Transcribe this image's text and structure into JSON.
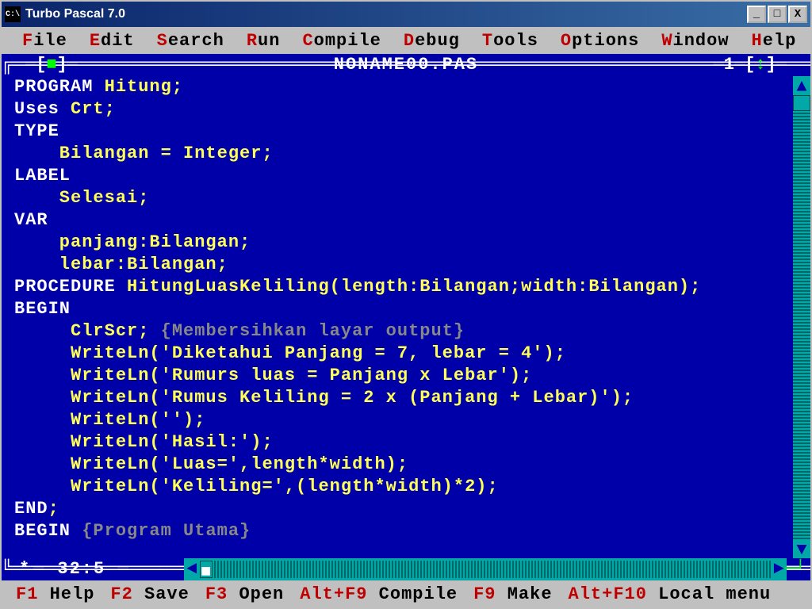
{
  "titlebar": {
    "icon_text": "C:\\",
    "title": "Turbo Pascal 7.0",
    "min": "_",
    "max": "□",
    "close": "X"
  },
  "menu": {
    "file": {
      "hot": "F",
      "rest": "ile"
    },
    "edit": {
      "hot": "E",
      "rest": "dit"
    },
    "search": {
      "hot": "S",
      "rest": "earch"
    },
    "run": {
      "hot": "R",
      "rest": "un"
    },
    "compile": {
      "hot": "C",
      "rest": "ompile"
    },
    "debug": {
      "hot": "D",
      "rest": "ebug"
    },
    "tools": {
      "hot": "T",
      "rest": "ools"
    },
    "options": {
      "hot": "O",
      "rest": "ptions"
    },
    "window": {
      "hot": "W",
      "rest": "indow"
    },
    "help": {
      "hot": "H",
      "rest": "elp"
    }
  },
  "editor": {
    "filename": "NONAME00.PAS",
    "window_num": "1",
    "cursor": "32:5",
    "modified": "*",
    "lines": [
      {
        "t": "PROGRAM",
        "r": " Hitung;",
        "kw": true
      },
      {
        "t": "Uses",
        "r": " Crt;",
        "kw": true
      },
      {
        "t": "TYPE",
        "r": "",
        "kw": true
      },
      {
        "t": "",
        "r": "    Bilangan = Integer;",
        "kw": false
      },
      {
        "t": "LABEL",
        "r": "",
        "kw": true
      },
      {
        "t": "",
        "r": "    Selesai;",
        "kw": false
      },
      {
        "t": "VAR",
        "r": "",
        "kw": true
      },
      {
        "t": "",
        "r": "    panjang:Bilangan;",
        "kw": false
      },
      {
        "t": "",
        "r": "    lebar:Bilangan;",
        "kw": false
      },
      {
        "t": "PROCEDURE",
        "r": " HitungLuasKeliling(length:Bilangan;width:Bilangan);",
        "kw": true
      },
      {
        "t": "BEGIN",
        "r": "",
        "kw": true
      },
      {
        "t": "",
        "r": "     ClrScr; ",
        "cm": "{Membersihkan layar output}",
        "kw": false
      },
      {
        "t": "",
        "r": "     WriteLn('Diketahui Panjang = 7, lebar = 4');",
        "kw": false
      },
      {
        "t": "",
        "r": "     WriteLn('Rumurs luas = Panjang x Lebar');",
        "kw": false
      },
      {
        "t": "",
        "r": "     WriteLn('Rumus Keliling = 2 x (Panjang + Lebar)');",
        "kw": false
      },
      {
        "t": "",
        "r": "     WriteLn('');",
        "kw": false
      },
      {
        "t": "",
        "r": "     WriteLn('Hasil:');",
        "kw": false
      },
      {
        "t": "",
        "r": "     WriteLn('Luas=',length*width);",
        "kw": false
      },
      {
        "t": "",
        "r": "     WriteLn('Keliling=',(length*width)*2);",
        "kw": false
      },
      {
        "t": "END",
        "r": ";",
        "kw": true
      },
      {
        "t": "BEGIN",
        "r": " ",
        "cm": "{Program Utama}",
        "kw": true
      }
    ]
  },
  "status": {
    "f1": {
      "k": "F1",
      "l": " Help"
    },
    "f2": {
      "k": "F2",
      "l": " Save"
    },
    "f3": {
      "k": "F3",
      "l": " Open"
    },
    "altf9": {
      "k": "Alt+F9",
      "l": " Compile"
    },
    "f9": {
      "k": "F9",
      "l": " Make"
    },
    "altf10": {
      "k": "Alt+F10",
      "l": " Local menu"
    }
  }
}
